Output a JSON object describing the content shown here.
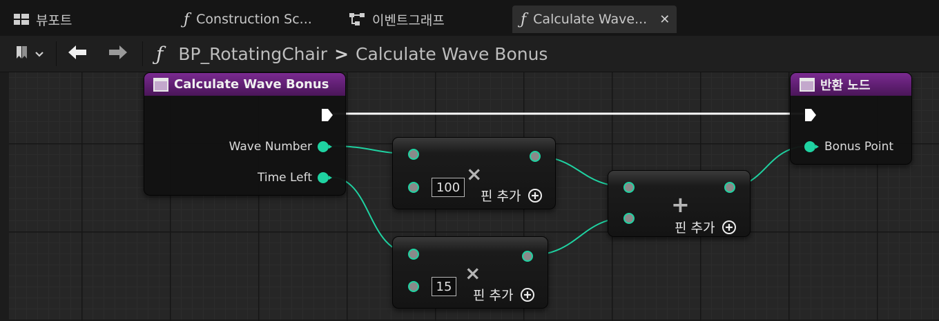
{
  "tabs": [
    {
      "label": "뷰포트",
      "icon": "viewport-grid-icon"
    },
    {
      "label": "Construction Sc...",
      "icon": "function-icon"
    },
    {
      "label": "이벤트그래프",
      "icon": "event-graph-icon"
    },
    {
      "label": "Calculate Wave...",
      "icon": "function-icon",
      "active": true
    }
  ],
  "toolbar": {
    "breadcrumb": {
      "root": "BP_RotatingChair",
      "separator": ">",
      "current": "Calculate Wave Bonus"
    }
  },
  "nodes": {
    "entry": {
      "title": "Calculate Wave Bonus",
      "pins": [
        "Wave Number",
        "Time Left"
      ]
    },
    "multiply_a": {
      "operator": "×",
      "value": "100",
      "add_pin": "핀 추가"
    },
    "multiply_b": {
      "operator": "×",
      "value": "15",
      "add_pin": "핀 추가"
    },
    "add": {
      "operator": "+",
      "add_pin": "핀 추가"
    },
    "return": {
      "title": "반환 노드",
      "pins": [
        "Bonus Point"
      ]
    }
  },
  "colors": {
    "node_header": "#7a2a90",
    "pin_data": "#1fd3a2",
    "wire_exec": "#ffffff",
    "background": "#242424"
  }
}
